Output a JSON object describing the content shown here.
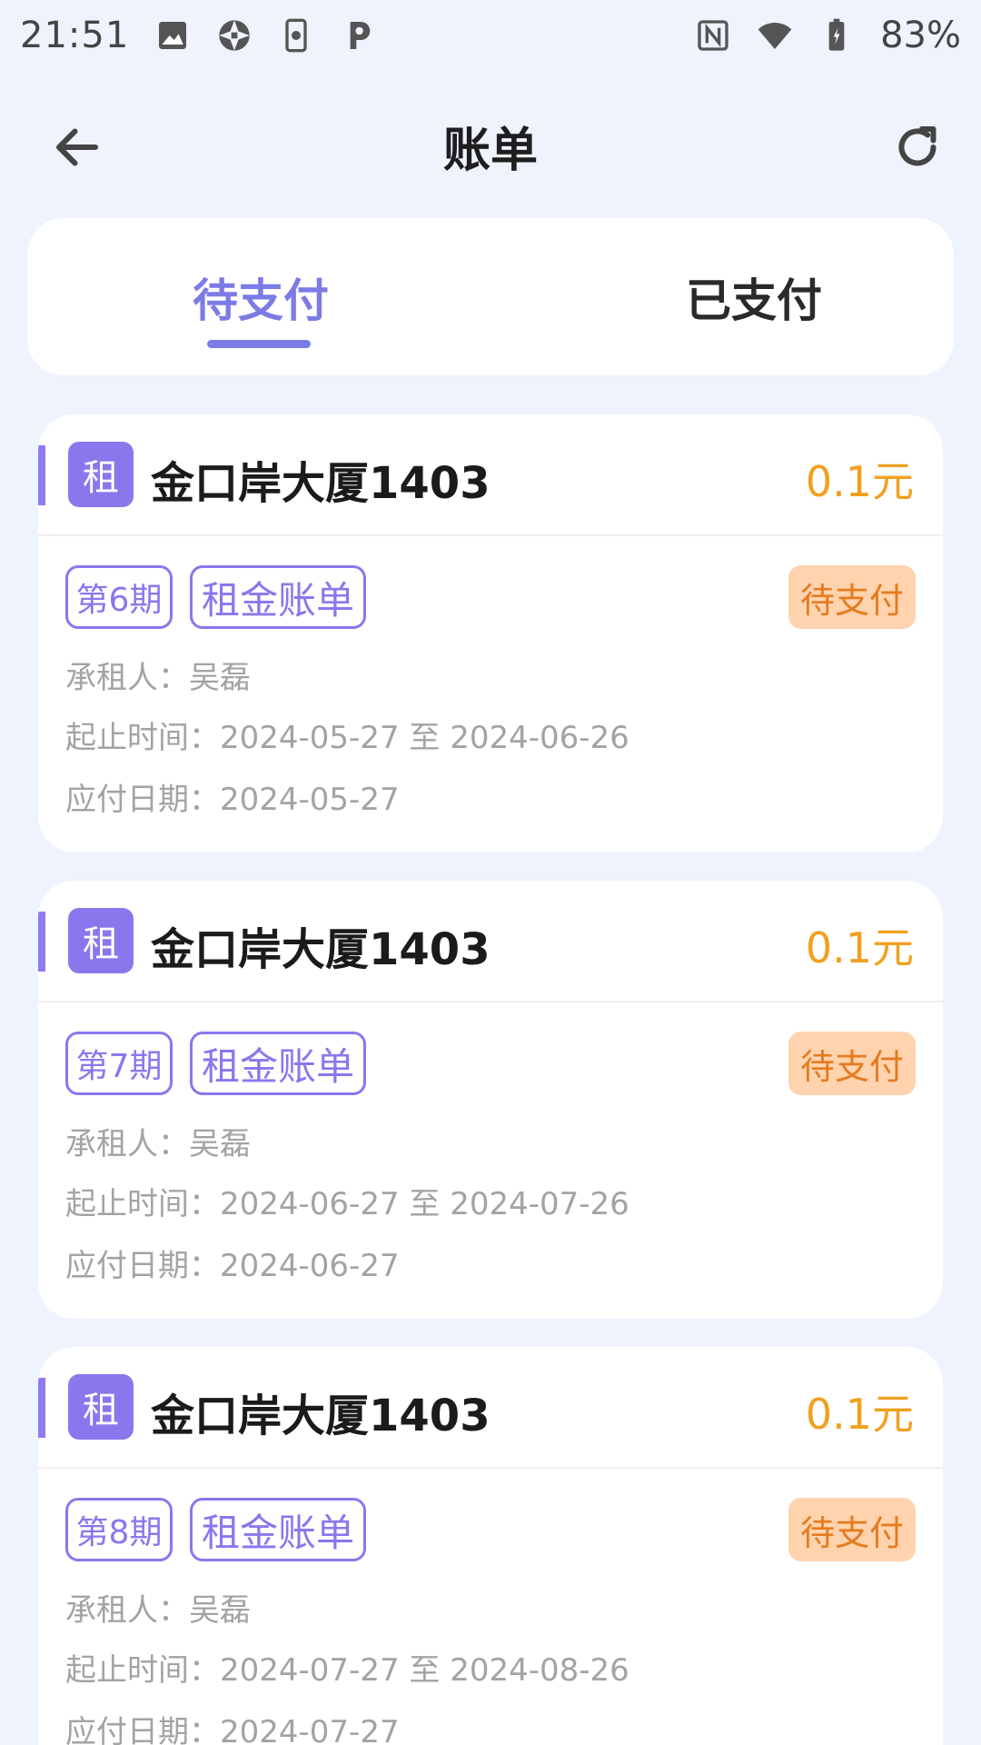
{
  "status_bar": {
    "time": "21:51",
    "left_icons": [
      "image-icon",
      "aperture-icon",
      "phone-settings-icon",
      "p-app-icon"
    ],
    "right_icons": [
      "nfc-icon",
      "wifi-icon",
      "battery-icon"
    ],
    "battery": "83%"
  },
  "header": {
    "title": "账单",
    "back_icon": "arrow-left-icon",
    "refresh_icon": "refresh-icon"
  },
  "tabs": [
    {
      "label": "待支付",
      "active": true
    },
    {
      "label": "已支付",
      "active": false
    }
  ],
  "bills": [
    {
      "badge": "租",
      "property": "金口岸大厦1403",
      "amount": "0.1元",
      "period": "第6期",
      "bill_type": "租金账单",
      "status": "待支付",
      "tenant_label": "承租人：",
      "tenant": "吴磊",
      "range_label": "起止时间：",
      "range": "2024-05-27 至 2024-06-26",
      "due_label": "应付日期：",
      "due": "2024-05-27"
    },
    {
      "badge": "租",
      "property": "金口岸大厦1403",
      "amount": "0.1元",
      "period": "第7期",
      "bill_type": "租金账单",
      "status": "待支付",
      "tenant_label": "承租人：",
      "tenant": "吴磊",
      "range_label": "起止时间：",
      "range": "2024-06-27 至 2024-07-26",
      "due_label": "应付日期：",
      "due": "2024-06-27"
    },
    {
      "badge": "租",
      "property": "金口岸大厦1403",
      "amount": "0.1元",
      "period": "第8期",
      "bill_type": "租金账单",
      "status": "待支付",
      "tenant_label": "承租人：",
      "tenant": "吴磊",
      "range_label": "起止时间：",
      "range": "2024-07-27 至 2024-08-26",
      "due_label": "应付日期：",
      "due": "2024-07-27"
    }
  ],
  "colors": {
    "accent": "#7C7BE6",
    "badge": "#8A77EE",
    "amount": "#F0A020",
    "status_bg": "#FFD3AE",
    "status_text": "#E57B20",
    "background": "#EEF3FE"
  }
}
